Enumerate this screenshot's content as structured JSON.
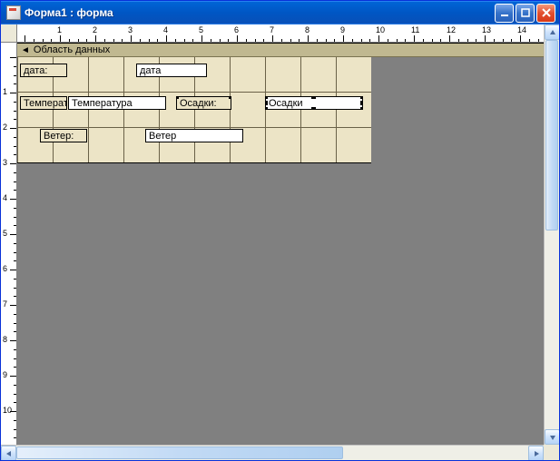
{
  "window": {
    "title": "Форма1 : форма"
  },
  "section": {
    "detail_header": "Область данных"
  },
  "fields": {
    "date": {
      "label": "дата:",
      "bound": "дата"
    },
    "temperature": {
      "label": "Температ",
      "bound": "Температура"
    },
    "precip": {
      "label": "Осадки:",
      "bound": "Осадки"
    },
    "wind": {
      "label": "Ветер:",
      "bound": "Ветер"
    }
  },
  "ruler": {
    "h_max": 14,
    "v_max": 10
  }
}
